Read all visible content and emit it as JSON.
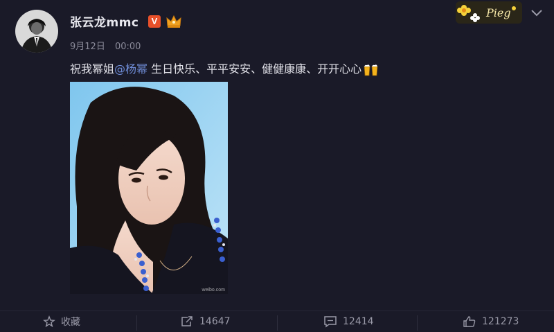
{
  "post": {
    "author": "张云龙mmc",
    "verified_badge": "V",
    "date": "9月12日",
    "time": "00:00",
    "text_before": "祝我幂姐",
    "mention": "@杨幂",
    "text_after": " 生日快乐、平平安安、健健康康、开开心心",
    "emoji": "beer-cheers-emoji",
    "image_watermark": "weibo.com",
    "decoration_text": "Pieg"
  },
  "actions": {
    "favorite_label": "收藏",
    "repost_count": "14647",
    "comment_count": "12414",
    "like_count": "121273"
  },
  "colors": {
    "background": "#1a1a28",
    "mention": "#6f8cd6",
    "verified": "#e8502a",
    "crown": "#f0a020"
  }
}
